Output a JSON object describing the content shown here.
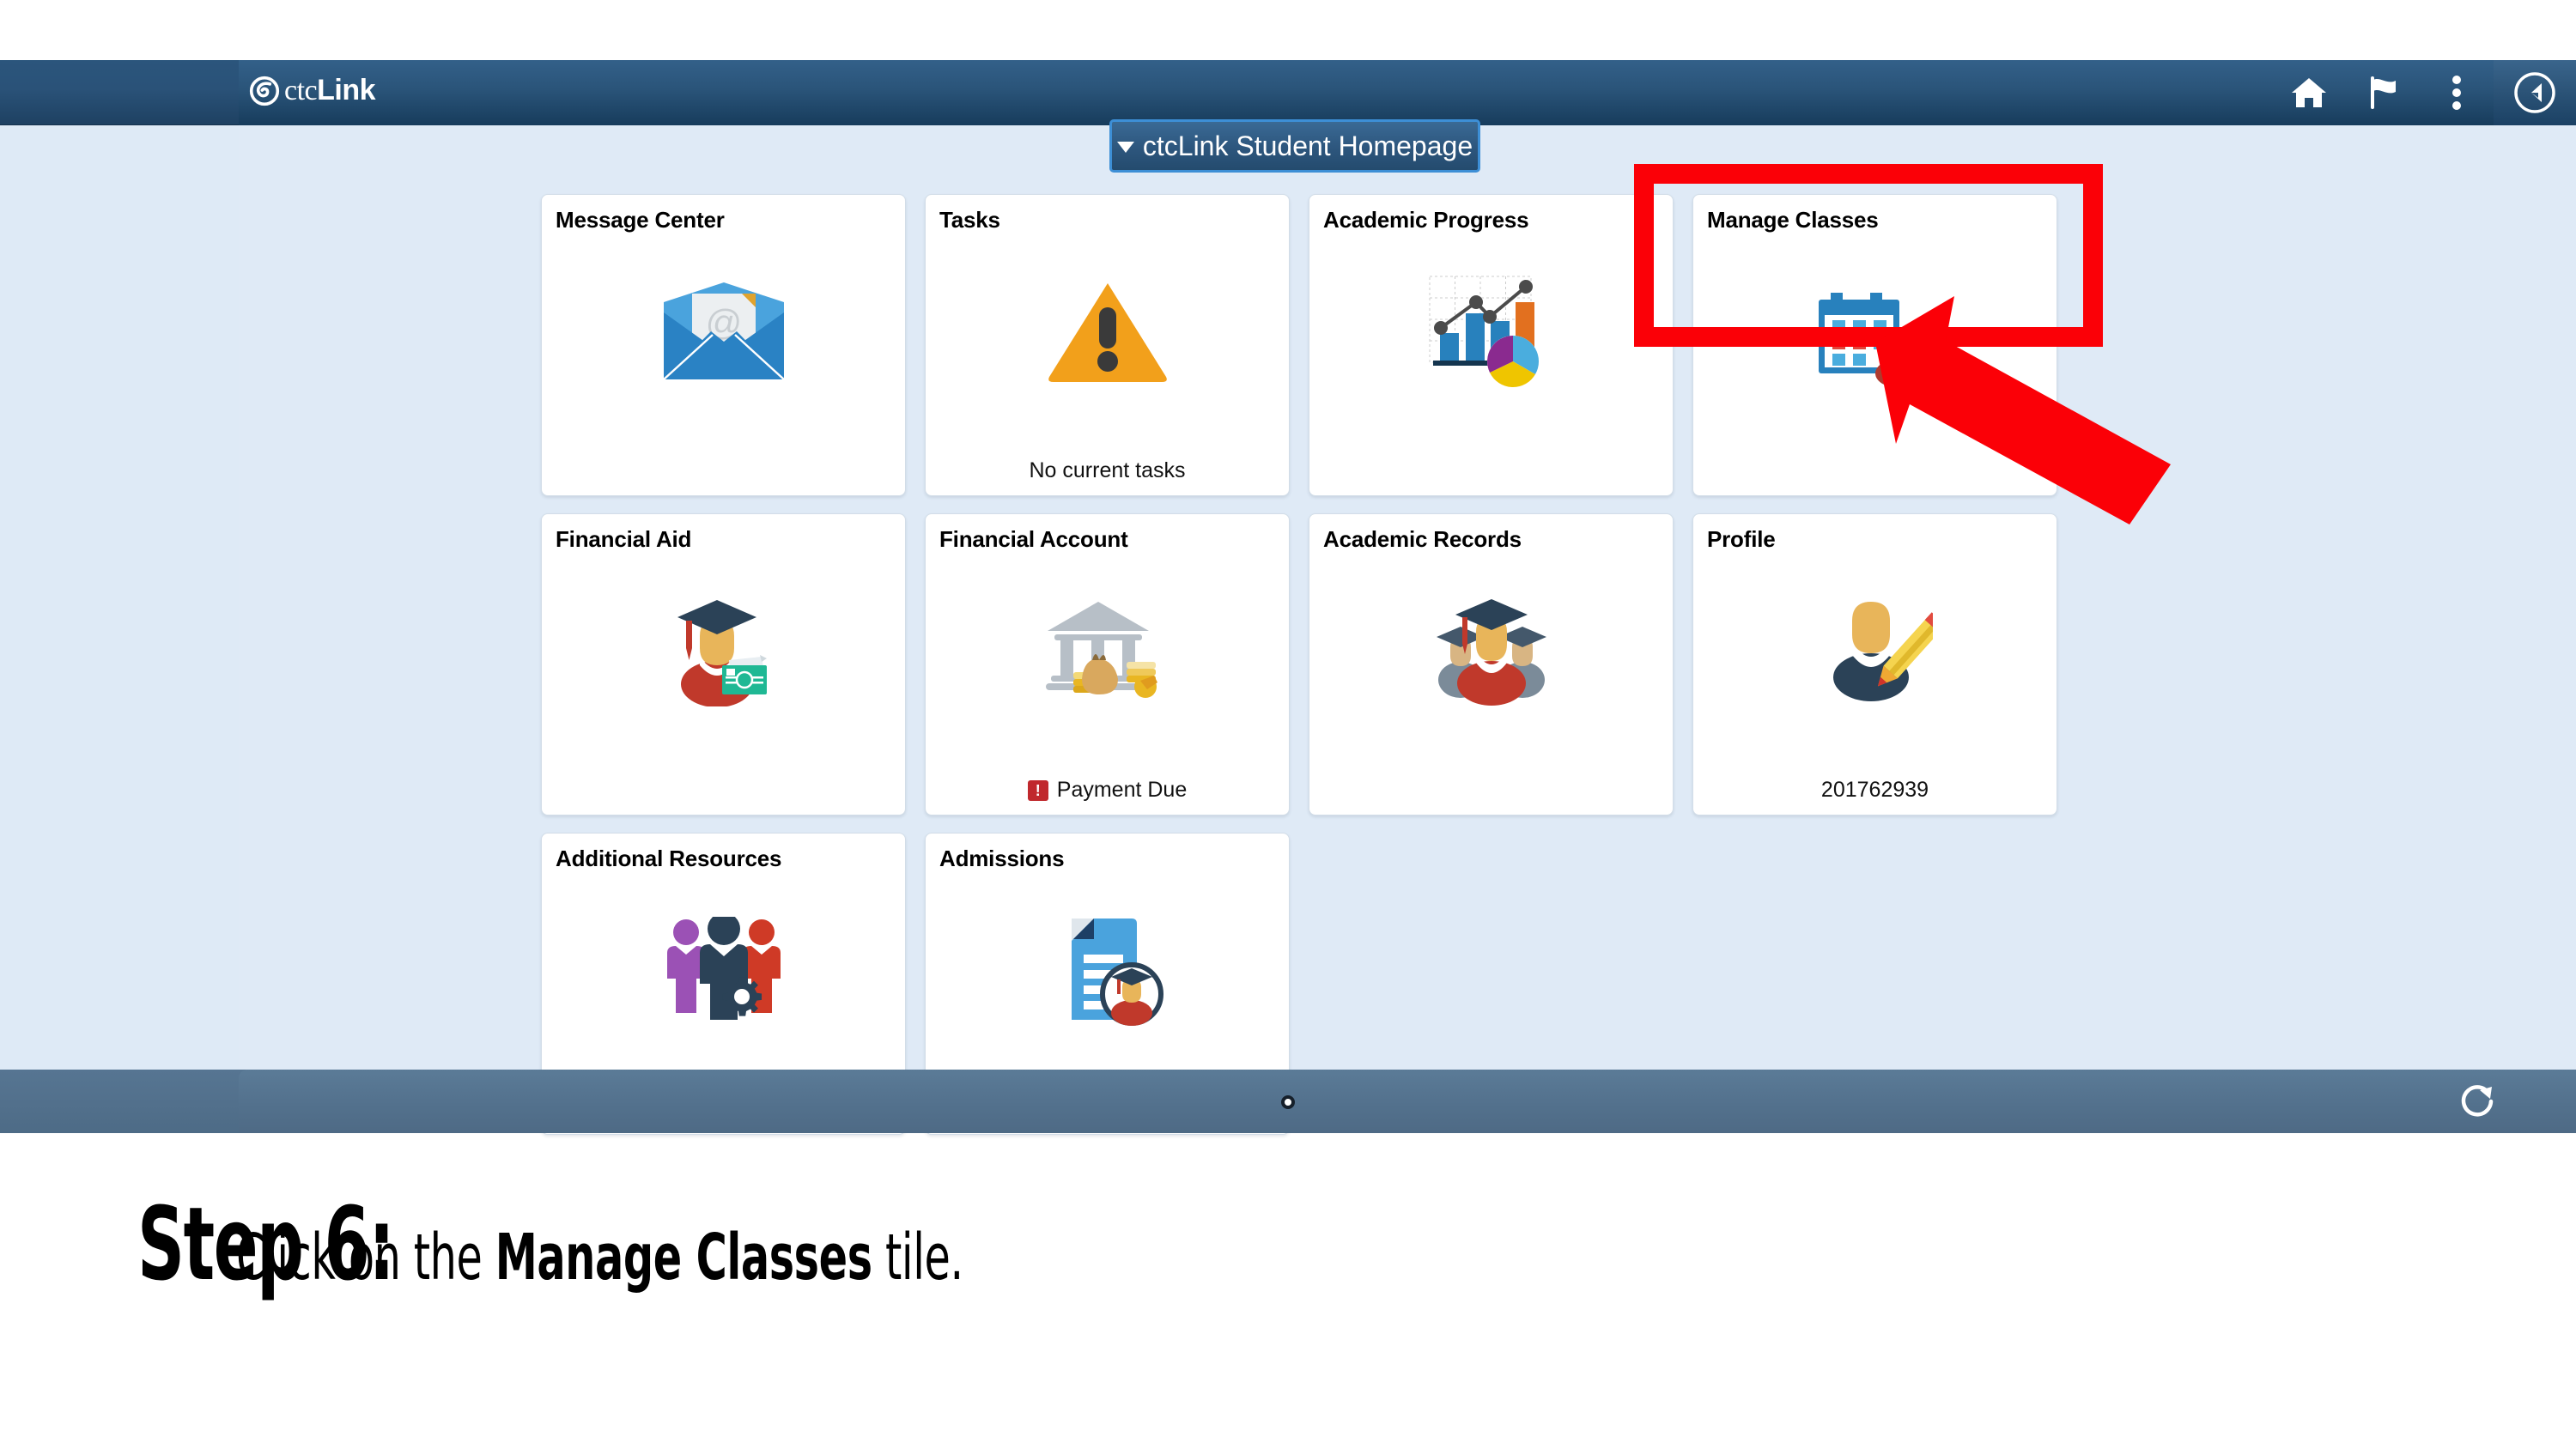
{
  "header": {
    "brand_prefix": "ctc",
    "brand_suffix": "Link",
    "logo_icon": "ctclink-spiral-logo-icon",
    "page_title": "ctcLink Student Homepage",
    "title_caret_icon": "chevron-down-icon",
    "icons": [
      {
        "name": "home-icon",
        "label": "Home"
      },
      {
        "name": "flag-icon",
        "label": "Notifications"
      },
      {
        "name": "kebab-menu-icon",
        "label": "Actions"
      },
      {
        "name": "navbar-compass-icon",
        "label": "NavBar"
      }
    ]
  },
  "tiles": [
    {
      "title": "Message Center",
      "icon": "envelope-at-icon",
      "footer": "",
      "badge": "",
      "highlighted": false
    },
    {
      "title": "Tasks",
      "icon": "warning-triangle-icon",
      "footer": "No current tasks",
      "badge": "",
      "highlighted": false
    },
    {
      "title": "Academic Progress",
      "icon": "bar-line-pie-chart-icon",
      "footer": "",
      "badge": "",
      "highlighted": false
    },
    {
      "title": "Manage Classes",
      "icon": "calendar-graduate-icon",
      "footer": "",
      "badge": "",
      "highlighted": true
    },
    {
      "title": "Financial Aid",
      "icon": "graduate-money-icon",
      "footer": "",
      "badge": "",
      "highlighted": false
    },
    {
      "title": "Financial Account",
      "icon": "bank-coins-icon",
      "footer": "Payment Due",
      "badge": "!",
      "highlighted": false
    },
    {
      "title": "Academic Records",
      "icon": "graduates-group-icon",
      "footer": "",
      "badge": "",
      "highlighted": false
    },
    {
      "title": "Profile",
      "icon": "person-pencil-icon",
      "footer": "201762939",
      "badge": "",
      "highlighted": false
    },
    {
      "title": "Additional Resources",
      "icon": "people-gear-icon",
      "footer": "",
      "badge": "",
      "highlighted": false
    },
    {
      "title": "Admissions",
      "icon": "document-graduate-icon",
      "footer": "",
      "badge": "",
      "highlighted": false
    }
  ],
  "bottom_bar": {
    "page_indicator_icon": "page-dot-indicator",
    "refresh_icon": "refresh-icon"
  },
  "annotation": {
    "highlight_box_color": "#FB0007",
    "arrow_icon": "red-pointer-arrow",
    "arrow_target": "Manage Classes"
  },
  "caption": {
    "step_label": "Step 6:",
    "instruction_before": "Click on the ",
    "instruction_emphasis": "Manage Classes",
    "instruction_after": " tile."
  },
  "colors": {
    "header_blue": "#2A5479",
    "canvas_blue": "#DFEAF6",
    "bottom_bar": "#53718D",
    "accent_red": "#FB0007",
    "title_border": "#3D8FD6"
  }
}
